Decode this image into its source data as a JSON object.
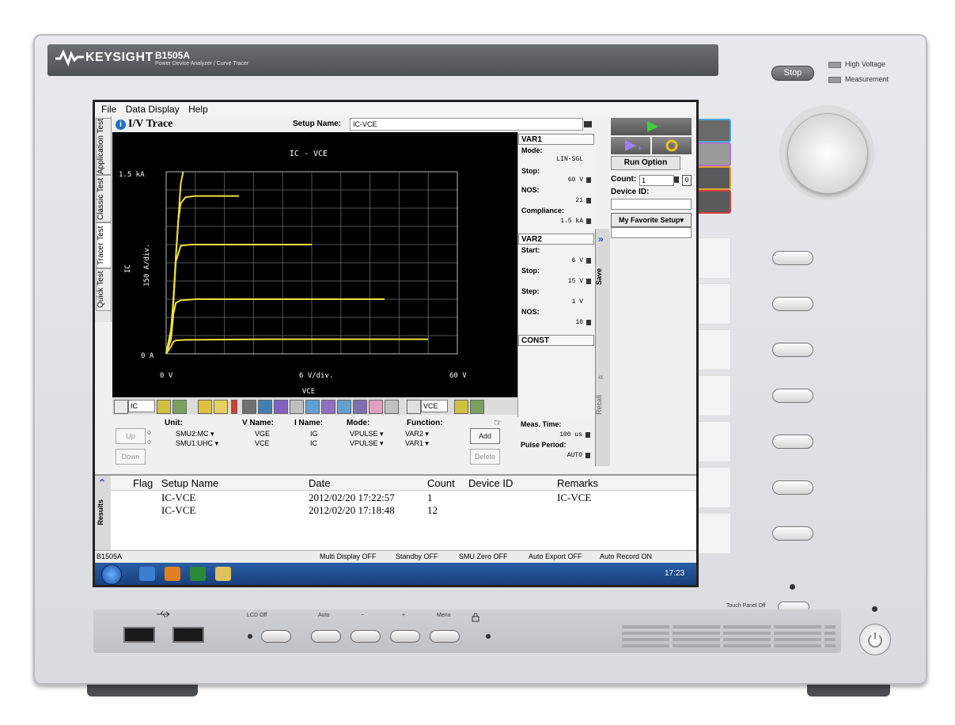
{
  "instrument": {
    "brand": "KEYSIGHT",
    "model": "B1505A",
    "model_sub": "Power Device Analyzer / Curve Tracer",
    "stop_label": "Stop",
    "indicator_high_voltage": "High Voltage",
    "indicator_measurement": "Measurement",
    "touch_panel_label": "Touch Panel Off",
    "front": {
      "lcd_off": "LCD Off",
      "auto": "Auto",
      "minus": "−",
      "plus": "+",
      "menu": "Menu"
    }
  },
  "menu": {
    "file": "File",
    "data_display": "Data Display",
    "help": "Help"
  },
  "tabs": [
    "Application Test",
    "Classic Test",
    "Tracer Test",
    "Quick Test"
  ],
  "page": {
    "title": "I/V Trace",
    "setup_name_label": "Setup Name:",
    "setup_name_value": "IC-VCE"
  },
  "chart_data": {
    "type": "line",
    "title": "IC - VCE",
    "xlabel": "VCE",
    "ylabel": "IC",
    "y_div_label": "150 A/div.",
    "x_div_label": "6 V/div.",
    "x_tick_left": "0 V",
    "x_tick_right": "60 V",
    "y_tick_top": "1.5 kA",
    "y_tick_bottom": "0 A",
    "xlim": [
      0,
      60
    ],
    "ylim": [
      0,
      1500
    ],
    "grid": true,
    "color": "#f0e040",
    "series": [
      {
        "x": [
          0,
          1,
          1.5,
          2,
          2.5,
          3,
          4,
          6,
          15
        ],
        "y": [
          0,
          180,
          420,
          800,
          1100,
          1240,
          1290,
          1300,
          1300
        ]
      },
      {
        "x": [
          0,
          1,
          1.5,
          2,
          3,
          5,
          12,
          30
        ],
        "y": [
          0,
          150,
          450,
          760,
          890,
          900,
          900,
          900
        ]
      },
      {
        "x": [
          0,
          1,
          1.5,
          2,
          3,
          6,
          20,
          45
        ],
        "y": [
          0,
          120,
          330,
          420,
          440,
          450,
          450,
          450
        ]
      },
      {
        "x": [
          0,
          1,
          1.5,
          2,
          4,
          20,
          54
        ],
        "y": [
          0,
          60,
          100,
          110,
          115,
          120,
          120
        ]
      },
      {
        "x": [
          0,
          1,
          1.5,
          2,
          2.5,
          3,
          3.5
        ],
        "y": [
          0,
          200,
          450,
          800,
          1100,
          1400,
          1500
        ]
      }
    ]
  },
  "var1": {
    "header": "VAR1",
    "mode_label": "Mode:",
    "mode_value": "LIN-SGL",
    "stop_label": "Stop:",
    "stop_value": "60 V",
    "nos_label": "NOS:",
    "nos_value": "21",
    "compliance_label": "Compliance:",
    "compliance_value": "1.5 kA"
  },
  "var2": {
    "header": "VAR2",
    "start_label": "Start:",
    "start_value": "6 V",
    "stop_label": "Stop:",
    "stop_value": "15 V",
    "step_label": "Step:",
    "step_value": "1 V",
    "nos_label": "NOS:",
    "nos_value": "10"
  },
  "const_header": "CONST",
  "save_label": "Save",
  "recall_label": "Recall",
  "run": {
    "run_option": "Run Option",
    "count_label": "Count:",
    "count_value": "1",
    "count_btn": "0",
    "device_id_label": "Device ID:",
    "favorite_label": "My Favorite Setup▾"
  },
  "toolbar": {
    "y_axis_select": "IC",
    "x_axis_select": "VCE"
  },
  "smu": {
    "headers": {
      "unit": "Unit:",
      "vname": "V Name:",
      "iname": "I Name:",
      "mode": "Mode:",
      "function": "Function:"
    },
    "rows": [
      {
        "unit": "SMU2:MC ▾",
        "vname": "VGE",
        "iname": "IG",
        "mode": "VPULSE ▾",
        "function": "VAR2 ▾"
      },
      {
        "unit": "SMU1:UHC ▾",
        "vname": "VCE",
        "iname": "IC",
        "mode": "VPULSE ▾",
        "function": "VAR1 ▾"
      }
    ],
    "up": "Up",
    "down": "Down",
    "add": "Add",
    "delete": "Delete"
  },
  "meas": {
    "time_label": "Meas. Time:",
    "time_value": "100 us",
    "pulse_label": "Pulse Period:",
    "pulse_value": "AUTO"
  },
  "results": {
    "side_label": "Results",
    "columns": [
      "Flag",
      "Setup Name",
      "Date",
      "Count",
      "Device ID",
      "Remarks"
    ],
    "rows": [
      {
        "setup": "IC-VCE",
        "date": "2012/02/20 17:22:57",
        "count": "1",
        "device": "",
        "remarks": "IC-VCE"
      },
      {
        "setup": "IC-VCE",
        "date": "2012/02/20 17:18:48",
        "count": "12",
        "device": "",
        "remarks": ""
      }
    ]
  },
  "status": {
    "left": "B1505A",
    "multi_display": "Multi Display OFF",
    "standby": "Standby OFF",
    "smu_zero": "SMU Zero OFF",
    "auto_export": "Auto Export OFF",
    "auto_record": "Auto Record ON"
  },
  "taskbar": {
    "clock": "17:23"
  }
}
